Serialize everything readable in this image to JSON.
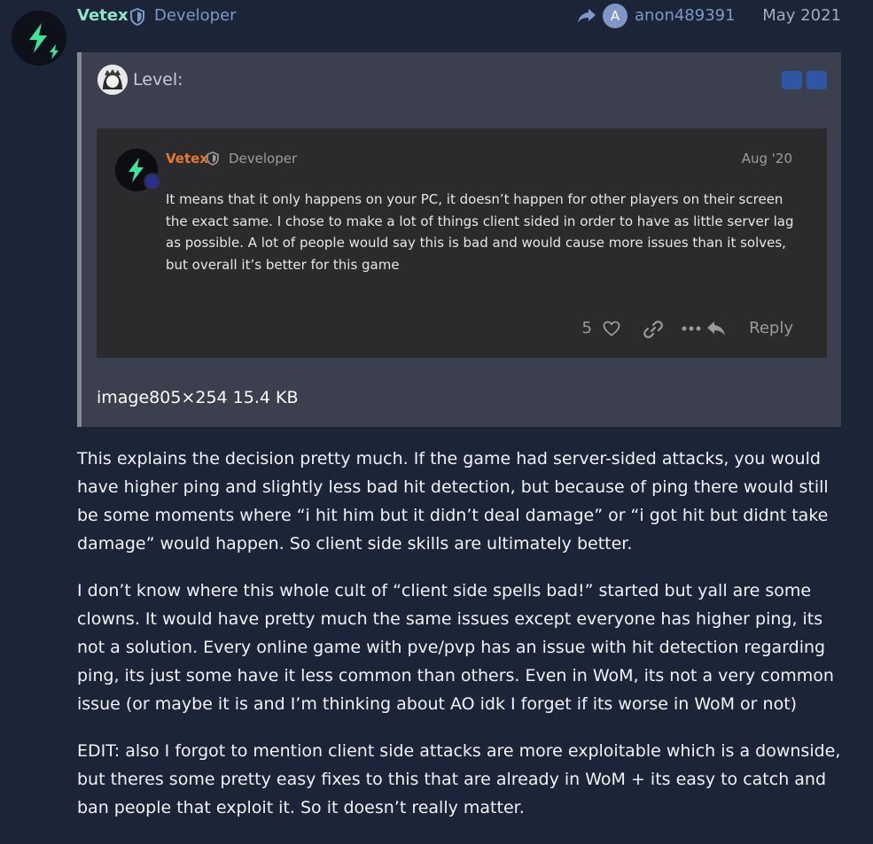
{
  "header": {
    "author_name": "Vetex",
    "author_title": "Developer",
    "reply_to_user": "anon489391",
    "reply_to_avatar_letter": "A",
    "date": "May 2021"
  },
  "quote": {
    "title": "Level:",
    "embed": {
      "author_name": "Vetex",
      "author_title": "Developer",
      "date": "Aug '20",
      "text": "It means that it only happens on your PC, it doesn’t happen for other players on their screen the exact same. I chose to make a lot of things client sided in order to have as little server lag as possible. A lot of people would say this is bad and would cause more issues than it solves, but overall it’s better for this game",
      "like_count": "5",
      "reply_label": "Reply"
    },
    "image_meta": "image805×254 15.4 KB"
  },
  "body": {
    "paragraphs": [
      "This explains the decision pretty much. If the game had server-sided attacks, you would have higher ping and slightly less bad hit detection, but because of ping there would still be some moments where “i hit him but it didn’t deal damage” or “i got hit but didnt take damage” would happen. So client side skills are ultimately better.",
      "I don’t know where this whole cult of “client side spells bad!” started but yall are some clowns. It would have pretty much the same issues except everyone has higher ping, its not a solution. Every online game with pve/pvp has an issue with hit detection regarding ping, its just some have it less common than others. Even in WoM, its not a very common issue (or maybe it is and I’m thinking about AO idk I forget if its worse in WoM or not)",
      "EDIT: also I forgot to mention client side attacks are more exploitable which is a downside, but theres some pretty easy fixes to this that are already in WoM + its easy to catch and ban people that exploit it. So it doesn’t really matter."
    ]
  },
  "colors": {
    "background": "#1c2438",
    "author": "#8ce6c5",
    "title": "#7d98c7",
    "quote_bg": "#3b3f4e",
    "embed_bg": "#2b2b2d",
    "embed_author": "#ea7a2a",
    "accent_button": "#2f55a5"
  },
  "icons": {
    "avatar": "lightning-bolt-icon",
    "moderator": "shield-icon",
    "reply_to": "share-arrow-icon",
    "like": "heart-icon",
    "link": "link-icon",
    "more": "more-dots-icon",
    "reply": "reply-icon"
  }
}
